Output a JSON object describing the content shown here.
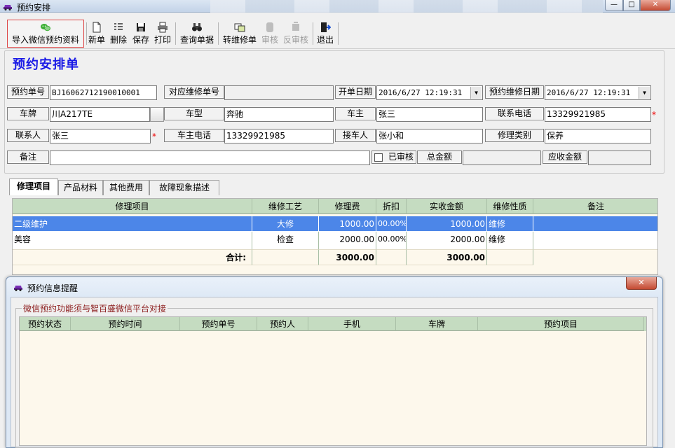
{
  "window": {
    "title": "预约安排"
  },
  "toolbar": {
    "import_label": "导入微信预约资料",
    "new_label": "新单",
    "delete_label": "删除",
    "save_label": "保存",
    "print_label": "打印",
    "query_label": "查询单据",
    "convert_label": "转维修单",
    "approve_label": "审核",
    "unapprove_label": "反审核",
    "exit_label": "退出"
  },
  "form": {
    "title": "预约安排单",
    "order_no_label": "预约单号",
    "order_no": "BJ16062712190010001",
    "repair_no_label": "对应维修单号",
    "repair_no": "",
    "open_date_label": "开单日期",
    "open_date": "2016/6/27 12:19:31",
    "repair_date_label": "预约维修日期",
    "repair_date": "2016/6/27 12:19:31",
    "plate_label": "车牌",
    "plate": "川A217TE",
    "model_label": "车型",
    "model": "奔驰",
    "owner_label": "车主",
    "owner": "张三",
    "phone_label": "联系电话",
    "phone": "13329921985",
    "contact_label": "联系人",
    "contact": "张三",
    "owner_phone_label": "车主电话",
    "owner_phone": "13329921985",
    "receiver_label": "接车人",
    "receiver": "张小和",
    "repair_type_label": "修理类别",
    "repair_type": "保养",
    "remark_label": "备注",
    "remark": "",
    "approved_label": "已审核",
    "total_label": "总金额",
    "total": "",
    "receivable_label": "应收金额",
    "receivable": "",
    "required_mark": "*"
  },
  "tabs": [
    "修理项目",
    "产品材料",
    "其他费用",
    "故障现象描述"
  ],
  "grid": {
    "columns": [
      "修理项目",
      "维修工艺",
      "修理费",
      "折扣",
      "实收金额",
      "维修性质",
      "备注"
    ],
    "rows": [
      {
        "item": "二级维护",
        "craft": "大修",
        "fee": "1000.00",
        "discount": "00.00%",
        "actual": "1000.00",
        "nature": "维修",
        "note": ""
      },
      {
        "item": "美容",
        "craft": "检查",
        "fee": "2000.00",
        "discount": "00.00%",
        "actual": "2000.00",
        "nature": "维修",
        "note": ""
      }
    ],
    "total_label": "合计:",
    "total_fee": "3000.00",
    "total_actual": "3000.00"
  },
  "dialog": {
    "title": "预约信息提醒",
    "group_title": "微信预约功能须与智百盛微信平台对接",
    "columns": [
      "预约状态",
      "预约时间",
      "预约单号",
      "预约人",
      "手机",
      "车牌",
      "预约项目"
    ]
  },
  "colors": {
    "title_blue": "#1a1ae6",
    "grid_header": "#c5dcc1",
    "grid_body": "#fdf8ec",
    "selected_row": "#4c86e8",
    "legend_red": "#8b1a1a"
  }
}
